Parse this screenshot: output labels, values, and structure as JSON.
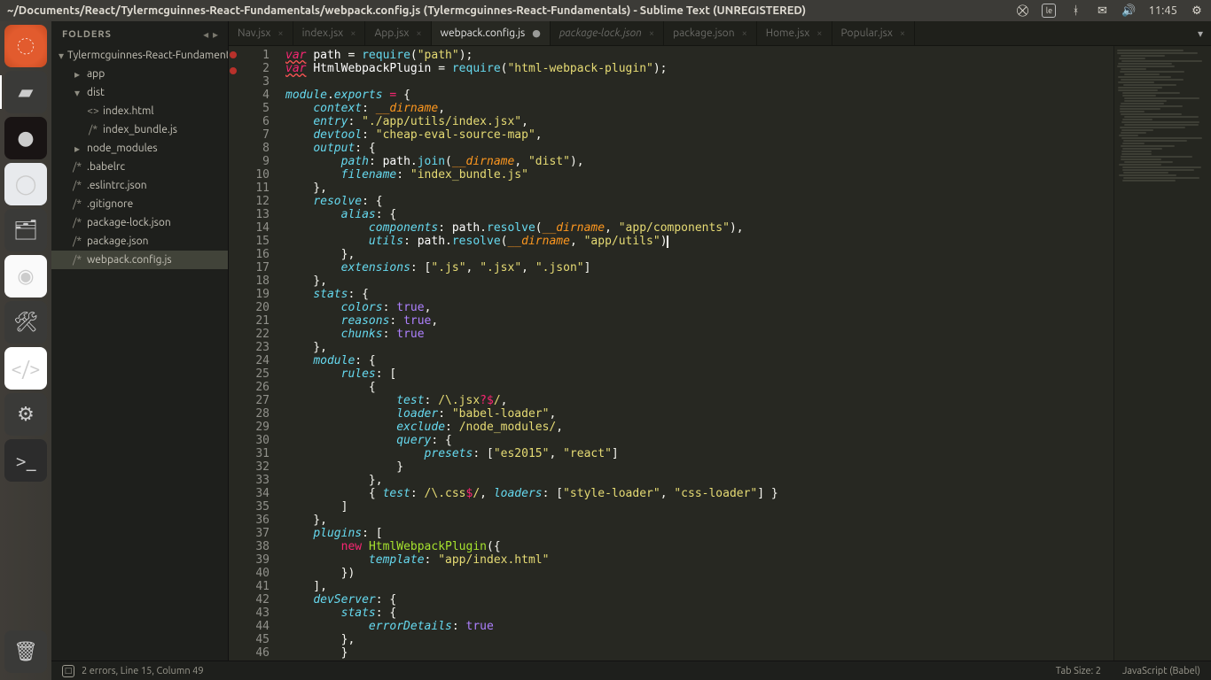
{
  "menubar": {
    "title": "~/Documents/React/Tylermcguinnes-React-Fundamentals/webpack.config.js (Tylermcguinnes-React-Fundamentals) - Sublime Text (UNREGISTERED)",
    "clock": "11:45"
  },
  "sidebar": {
    "header": "FOLDERS",
    "tree": [
      {
        "ind": 0,
        "icon": "▾",
        "type": "folder",
        "label": "Tylermcguinnes-React-Fundamentals"
      },
      {
        "ind": 1,
        "icon": "▸",
        "type": "folder",
        "label": "app"
      },
      {
        "ind": 1,
        "icon": "▾",
        "type": "folder",
        "label": "dist"
      },
      {
        "ind": 2,
        "icon": "<>",
        "type": "file",
        "label": "index.html"
      },
      {
        "ind": 2,
        "icon": "/*",
        "type": "file",
        "label": "index_bundle.js"
      },
      {
        "ind": 1,
        "icon": "▸",
        "type": "folder",
        "label": "node_modules"
      },
      {
        "ind": 1,
        "icon": "/*",
        "type": "file",
        "label": ".babelrc"
      },
      {
        "ind": 1,
        "icon": "/*",
        "type": "file",
        "label": ".eslintrc.json"
      },
      {
        "ind": 1,
        "icon": "/*",
        "type": "file",
        "label": ".gitignore"
      },
      {
        "ind": 1,
        "icon": "/*",
        "type": "file",
        "label": "package-lock.json"
      },
      {
        "ind": 1,
        "icon": "/*",
        "type": "file",
        "label": "package.json"
      },
      {
        "ind": 1,
        "icon": "/*",
        "type": "file",
        "label": "webpack.config.js",
        "selected": true
      }
    ]
  },
  "tabs": [
    {
      "label": "Nav.jsx",
      "dirty": false
    },
    {
      "label": "index.jsx",
      "dirty": false
    },
    {
      "label": "App.jsx",
      "dirty": false
    },
    {
      "label": "webpack.config.js",
      "dirty": true,
      "active": true
    },
    {
      "label": "package-lock.json",
      "dirty": false,
      "italic": true
    },
    {
      "label": "package.json",
      "dirty": false
    },
    {
      "label": "Home.jsx",
      "dirty": false
    },
    {
      "label": "Popular.jsx",
      "dirty": false
    }
  ],
  "file": {
    "path": "webpack.config.js",
    "lines": [
      [
        {
          "t": "var",
          "c": "c-kw u"
        },
        {
          "t": " "
        },
        {
          "t": "path",
          "c": "c-name"
        },
        {
          "t": " = "
        },
        {
          "t": "require",
          "c": "c-fn"
        },
        {
          "t": "("
        },
        {
          "t": "\"path\"",
          "c": "c-str"
        },
        {
          "t": ");"
        }
      ],
      [
        {
          "t": "var",
          "c": "c-kw u"
        },
        {
          "t": " "
        },
        {
          "t": "HtmlWebpackPlugin",
          "c": "c-name"
        },
        {
          "t": " = "
        },
        {
          "t": "require",
          "c": "c-fn"
        },
        {
          "t": "("
        },
        {
          "t": "\"html-webpack-plugin\"",
          "c": "c-str"
        },
        {
          "t": ");"
        }
      ],
      [],
      [
        {
          "t": "module",
          "c": "c-obj"
        },
        {
          "t": "."
        },
        {
          "t": "exports",
          "c": "c-obj"
        },
        {
          "t": " "
        },
        {
          "t": "=",
          "c": "c-kw2"
        },
        {
          "t": " {"
        }
      ],
      [
        {
          "t": "    "
        },
        {
          "t": "context",
          "c": "c-prop"
        },
        {
          "t": ": "
        },
        {
          "t": "__dirname",
          "c": "c-dir"
        },
        {
          "t": ","
        }
      ],
      [
        {
          "t": "    "
        },
        {
          "t": "entry",
          "c": "c-prop"
        },
        {
          "t": ": "
        },
        {
          "t": "\"./app/utils/index.jsx\"",
          "c": "c-str"
        },
        {
          "t": ","
        }
      ],
      [
        {
          "t": "    "
        },
        {
          "t": "devtool",
          "c": "c-prop"
        },
        {
          "t": ": "
        },
        {
          "t": "\"cheap-eval-source-map\"",
          "c": "c-str"
        },
        {
          "t": ","
        }
      ],
      [
        {
          "t": "    "
        },
        {
          "t": "output",
          "c": "c-prop"
        },
        {
          "t": ": {"
        }
      ],
      [
        {
          "t": "        "
        },
        {
          "t": "path",
          "c": "c-prop"
        },
        {
          "t": ": "
        },
        {
          "t": "path",
          "c": "c-name"
        },
        {
          "t": "."
        },
        {
          "t": "join",
          "c": "c-fn"
        },
        {
          "t": "("
        },
        {
          "t": "__dirname",
          "c": "c-dir"
        },
        {
          "t": ", "
        },
        {
          "t": "\"dist\"",
          "c": "c-str"
        },
        {
          "t": "),"
        }
      ],
      [
        {
          "t": "        "
        },
        {
          "t": "filename",
          "c": "c-prop"
        },
        {
          "t": ": "
        },
        {
          "t": "\"index_bundle.js\"",
          "c": "c-str"
        }
      ],
      [
        {
          "t": "    },"
        }
      ],
      [
        {
          "t": "    "
        },
        {
          "t": "resolve",
          "c": "c-prop"
        },
        {
          "t": ": {"
        }
      ],
      [
        {
          "t": "        "
        },
        {
          "t": "alias",
          "c": "c-prop"
        },
        {
          "t": ": {"
        }
      ],
      [
        {
          "t": "            "
        },
        {
          "t": "components",
          "c": "c-prop"
        },
        {
          "t": ": "
        },
        {
          "t": "path",
          "c": "c-name"
        },
        {
          "t": "."
        },
        {
          "t": "resolve",
          "c": "c-fn"
        },
        {
          "t": "("
        },
        {
          "t": "__dirname",
          "c": "c-dir"
        },
        {
          "t": ", "
        },
        {
          "t": "\"app/components\"",
          "c": "c-str"
        },
        {
          "t": "),"
        }
      ],
      [
        {
          "t": "            "
        },
        {
          "t": "utils",
          "c": "c-prop"
        },
        {
          "t": ": "
        },
        {
          "t": "path",
          "c": "c-name"
        },
        {
          "t": "."
        },
        {
          "t": "resolve",
          "c": "c-fn"
        },
        {
          "t": "("
        },
        {
          "t": "__dirname",
          "c": "c-dir"
        },
        {
          "t": ", "
        },
        {
          "t": "\"app/utils\"",
          "c": "c-str"
        },
        {
          "t": ""
        },
        {
          "t": ")",
          "cursor": true
        }
      ],
      [
        {
          "t": "        },"
        }
      ],
      [
        {
          "t": "        "
        },
        {
          "t": "extensions",
          "c": "c-prop"
        },
        {
          "t": ": ["
        },
        {
          "t": "\".js\"",
          "c": "c-str"
        },
        {
          "t": ", "
        },
        {
          "t": "\".jsx\"",
          "c": "c-str"
        },
        {
          "t": ", "
        },
        {
          "t": "\".json\"",
          "c": "c-str"
        },
        {
          "t": "]"
        }
      ],
      [
        {
          "t": "    },"
        }
      ],
      [
        {
          "t": "    "
        },
        {
          "t": "stats",
          "c": "c-prop"
        },
        {
          "t": ": {"
        }
      ],
      [
        {
          "t": "        "
        },
        {
          "t": "colors",
          "c": "c-prop"
        },
        {
          "t": ": "
        },
        {
          "t": "true",
          "c": "c-const"
        },
        {
          "t": ","
        }
      ],
      [
        {
          "t": "        "
        },
        {
          "t": "reasons",
          "c": "c-prop"
        },
        {
          "t": ": "
        },
        {
          "t": "true",
          "c": "c-const"
        },
        {
          "t": ","
        }
      ],
      [
        {
          "t": "        "
        },
        {
          "t": "chunks",
          "c": "c-prop"
        },
        {
          "t": ": "
        },
        {
          "t": "true",
          "c": "c-const"
        }
      ],
      [
        {
          "t": "    },"
        }
      ],
      [
        {
          "t": "    "
        },
        {
          "t": "module",
          "c": "c-prop"
        },
        {
          "t": ": {"
        }
      ],
      [
        {
          "t": "        "
        },
        {
          "t": "rules",
          "c": "c-prop"
        },
        {
          "t": ": ["
        }
      ],
      [
        {
          "t": "            {"
        }
      ],
      [
        {
          "t": "                "
        },
        {
          "t": "test",
          "c": "c-prop"
        },
        {
          "t": ": "
        },
        {
          "t": "/\\.jsx",
          "c": "c-re"
        },
        {
          "t": "?$",
          "c": "c-kw2"
        },
        {
          "t": "/",
          "c": "c-re"
        },
        {
          "t": ","
        }
      ],
      [
        {
          "t": "                "
        },
        {
          "t": "loader",
          "c": "c-prop"
        },
        {
          "t": ": "
        },
        {
          "t": "\"babel-loader\"",
          "c": "c-str"
        },
        {
          "t": ","
        }
      ],
      [
        {
          "t": "                "
        },
        {
          "t": "exclude",
          "c": "c-prop"
        },
        {
          "t": ": "
        },
        {
          "t": "/node_modules/",
          "c": "c-re"
        },
        {
          "t": ","
        }
      ],
      [
        {
          "t": "                "
        },
        {
          "t": "query",
          "c": "c-prop"
        },
        {
          "t": ": {"
        }
      ],
      [
        {
          "t": "                    "
        },
        {
          "t": "presets",
          "c": "c-prop"
        },
        {
          "t": ": ["
        },
        {
          "t": "\"es2015\"",
          "c": "c-str"
        },
        {
          "t": ", "
        },
        {
          "t": "\"react\"",
          "c": "c-str"
        },
        {
          "t": "]"
        }
      ],
      [
        {
          "t": "                }"
        }
      ],
      [
        {
          "t": "            },"
        }
      ],
      [
        {
          "t": "            { "
        },
        {
          "t": "test",
          "c": "c-prop"
        },
        {
          "t": ": "
        },
        {
          "t": "/\\.css",
          "c": "c-re"
        },
        {
          "t": "$",
          "c": "c-kw2"
        },
        {
          "t": "/",
          "c": "c-re"
        },
        {
          "t": ", "
        },
        {
          "t": "loaders",
          "c": "c-prop"
        },
        {
          "t": ": ["
        },
        {
          "t": "\"style-loader\"",
          "c": "c-str"
        },
        {
          "t": ", "
        },
        {
          "t": "\"css-loader\"",
          "c": "c-str"
        },
        {
          "t": "] }"
        }
      ],
      [
        {
          "t": "        ]"
        }
      ],
      [
        {
          "t": "    },"
        }
      ],
      [
        {
          "t": "    "
        },
        {
          "t": "plugins",
          "c": "c-prop"
        },
        {
          "t": ": ["
        }
      ],
      [
        {
          "t": "        "
        },
        {
          "t": "new",
          "c": "c-kw2"
        },
        {
          "t": " "
        },
        {
          "t": "HtmlWebpackPlugin",
          "c": "c-def"
        },
        {
          "t": "({"
        }
      ],
      [
        {
          "t": "            "
        },
        {
          "t": "template",
          "c": "c-prop"
        },
        {
          "t": ": "
        },
        {
          "t": "\"app/index.html\"",
          "c": "c-str"
        }
      ],
      [
        {
          "t": "        })"
        }
      ],
      [
        {
          "t": "    ],"
        }
      ],
      [
        {
          "t": "    "
        },
        {
          "t": "devServer",
          "c": "c-prop"
        },
        {
          "t": ": {"
        }
      ],
      [
        {
          "t": "        "
        },
        {
          "t": "stats",
          "c": "c-prop"
        },
        {
          "t": ": {"
        }
      ],
      [
        {
          "t": "            "
        },
        {
          "t": "errorDetails",
          "c": "c-prop"
        },
        {
          "t": ": "
        },
        {
          "t": "true",
          "c": "c-const"
        }
      ],
      [
        {
          "t": "        },"
        }
      ],
      [
        {
          "t": "        }"
        }
      ]
    ],
    "error_dots": [
      1,
      2
    ]
  },
  "status": {
    "errors": "2 errors, Line 15, Column 49",
    "tabsize": "Tab Size: 2",
    "syntax": "JavaScript (Babel)"
  },
  "launcher": [
    {
      "name": "ubuntu-dash",
      "cls": "li-ubuntu",
      "glyph": "◌"
    },
    {
      "name": "sublime-text",
      "cls": "li-sublime",
      "glyph": "▰",
      "selected": true
    },
    {
      "name": "spotify",
      "cls": "li-spotify",
      "glyph": "●"
    },
    {
      "name": "chromium",
      "cls": "li-chromium",
      "glyph": "◯"
    },
    {
      "name": "files",
      "cls": "li-files",
      "glyph": "🗂"
    },
    {
      "name": "chrome",
      "cls": "li-chrome",
      "glyph": "◉"
    },
    {
      "name": "settings",
      "cls": "li-settings",
      "glyph": "🛠"
    },
    {
      "name": "code-editor",
      "cls": "li-code",
      "glyph": "</>"
    },
    {
      "name": "system",
      "cls": "li-cog",
      "glyph": "⚙"
    },
    {
      "name": "terminal",
      "cls": "li-term",
      "glyph": ">_"
    }
  ]
}
